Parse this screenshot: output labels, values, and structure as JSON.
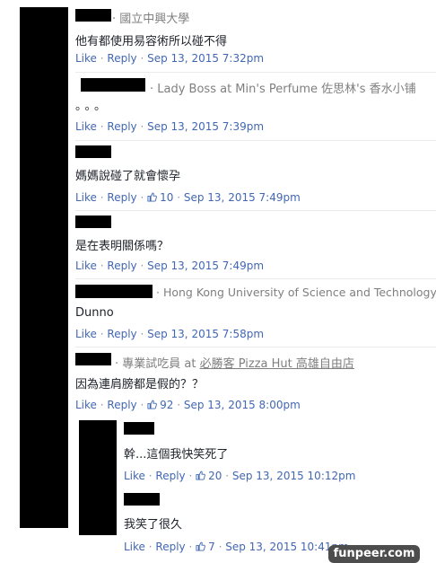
{
  "comments": [
    {
      "affiliation": "國立中興大學",
      "text": "他有都使用易容術所以碰不得",
      "like": "Like",
      "reply": "Reply",
      "time": "Sep 13, 2015 7:32pm"
    },
    {
      "affiliation": "Lady Boss at Min's Perfume 佐思林's 香水小铺",
      "text": "。。。",
      "like": "Like",
      "reply": "Reply",
      "time": "Sep 13, 2015 7:39pm"
    },
    {
      "text": "媽媽說碰了就會懷孕",
      "like": "Like",
      "reply": "Reply",
      "likes": "10",
      "time": "Sep 13, 2015 7:49pm"
    },
    {
      "text": "是在表明關係嗎？",
      "like": "Like",
      "reply": "Reply",
      "time": "Sep 13, 2015 7:49pm"
    },
    {
      "affiliation": "Hong Kong University of Science and Technology",
      "text": "Dunno",
      "like": "Like",
      "reply": "Reply",
      "time": "Sep 13, 2015 7:58pm"
    },
    {
      "affiliation_prefix": "專業試吃員 at ",
      "affiliation_link": "必勝客 Pizza Hut 高雄自由店",
      "text": "因為連肩膀都是假的？？",
      "like": "Like",
      "reply": "Reply",
      "likes": "92",
      "time": "Sep 13, 2015 8:00pm"
    }
  ],
  "replies": [
    {
      "text": "幹...這個我快笑死了",
      "like": "Like",
      "reply": "Reply",
      "likes": "20",
      "time": "Sep 13, 2015 10:12pm"
    },
    {
      "text": "我笑了很久",
      "like": "Like",
      "reply": "Reply",
      "likes": "7",
      "time": "Sep 13, 2015 10:41pm"
    }
  ],
  "watermark": "funpeer.com",
  "colors": {
    "link": "#4267b2",
    "meta": "#90949c",
    "text": "#1d2129",
    "redaction": "#000000"
  }
}
